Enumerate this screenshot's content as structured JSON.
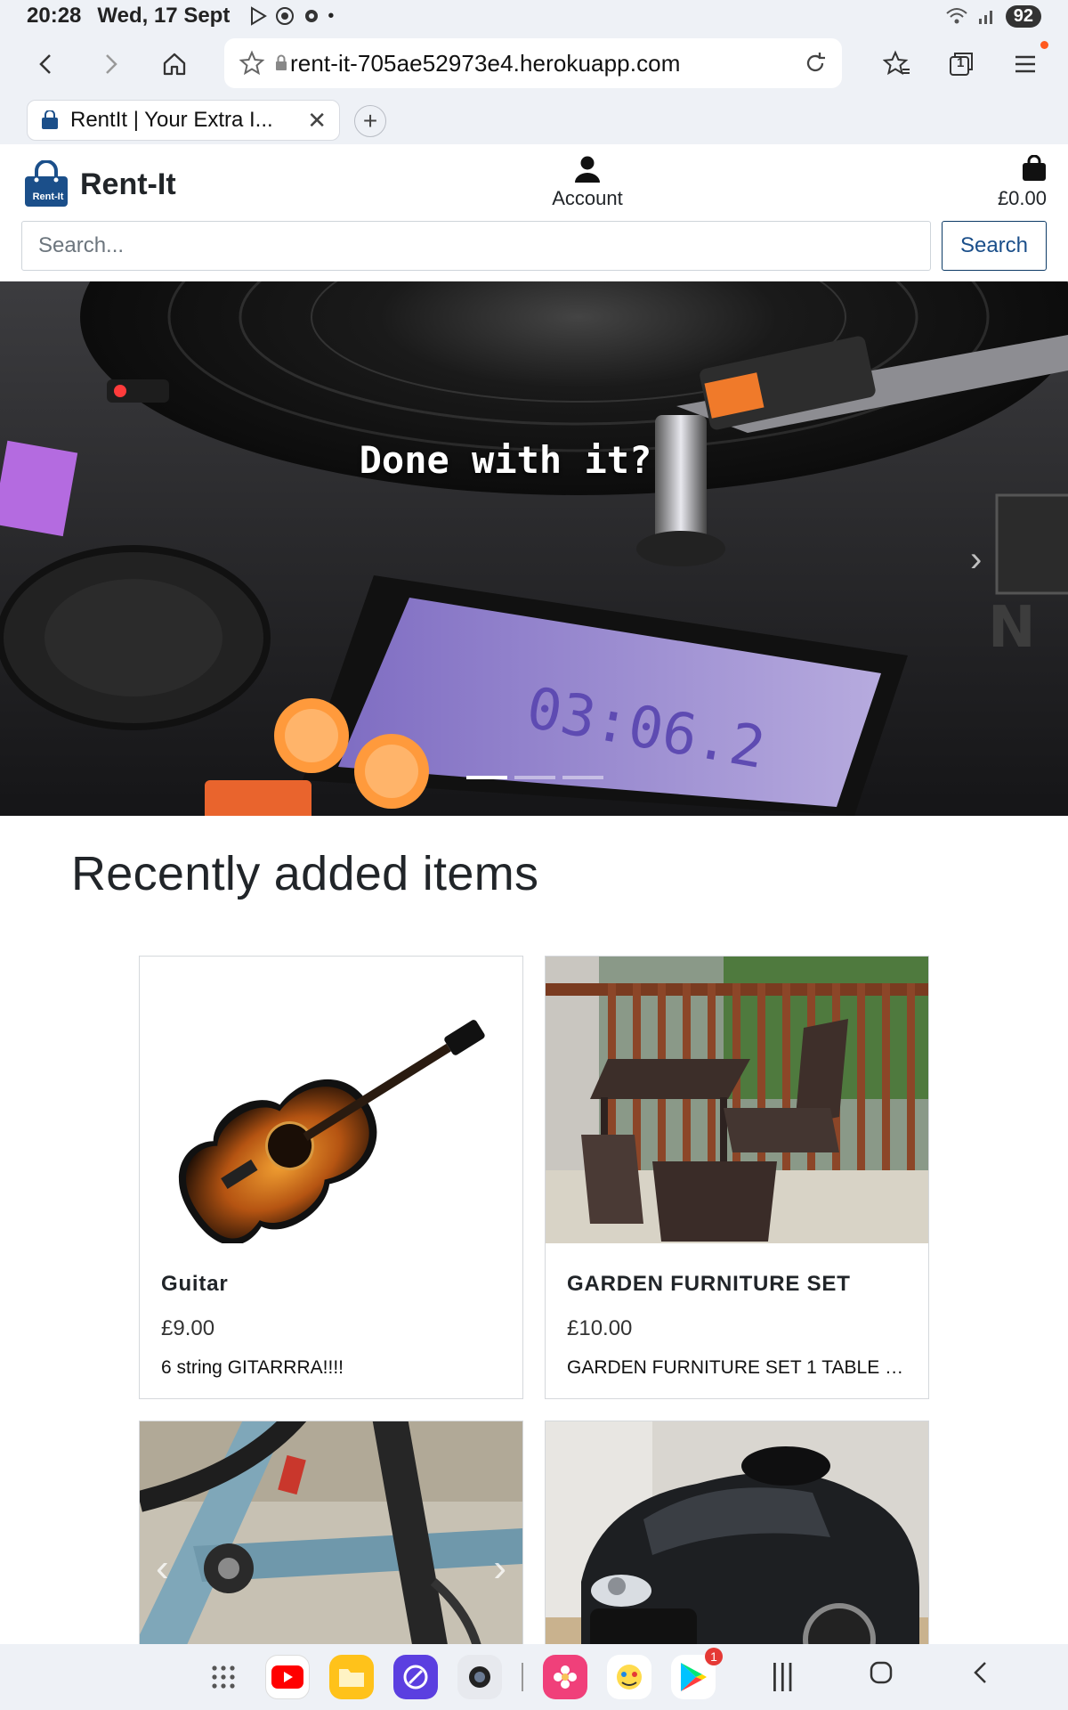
{
  "status_bar": {
    "time": "20:28",
    "date": "Wed, 17 Sept",
    "battery": "92"
  },
  "browser": {
    "url": "rent-it-705ae52973e4.herokuapp.com",
    "tab_title": "RentIt | Your Extra I...",
    "tab_count": "1",
    "icons": [
      "back-icon",
      "forward-icon",
      "home-icon",
      "bookmark-star-icon",
      "lock-icon",
      "reload-icon",
      "favorites-icon",
      "tabs-icon",
      "menu-icon"
    ]
  },
  "header": {
    "brand_name": "Rent-It",
    "logo_text": "Rent-It",
    "account_label": "Account",
    "bag_total": "£0.00",
    "search_placeholder": "Search...",
    "search_button": "Search"
  },
  "hero": {
    "caption": "Done with it?",
    "slides": 3,
    "active_slide": 1
  },
  "section": {
    "title": "Recently added items"
  },
  "items": [
    {
      "name": "Guitar",
      "price": "£9.00",
      "description": "6 string GITARRRA!!!!"
    },
    {
      "name": "GARDEN FURNITURE SET",
      "price": "£10.00",
      "description": "GARDEN FURNITURE SET 1 TABLE 2..."
    },
    {
      "name": "",
      "price": "",
      "description": ""
    },
    {
      "name": "",
      "price": "",
      "description": ""
    }
  ],
  "dock": {
    "apps": [
      "grid-icon",
      "youtube-icon",
      "files-icon",
      "browser-icon",
      "camera-icon",
      "gallery-icon",
      "game-icon",
      "play-store-icon"
    ],
    "play_store_badge": "1"
  },
  "colors": {
    "brand_blue": "#1b4f8a",
    "chrome_bg": "#eef1f6"
  }
}
